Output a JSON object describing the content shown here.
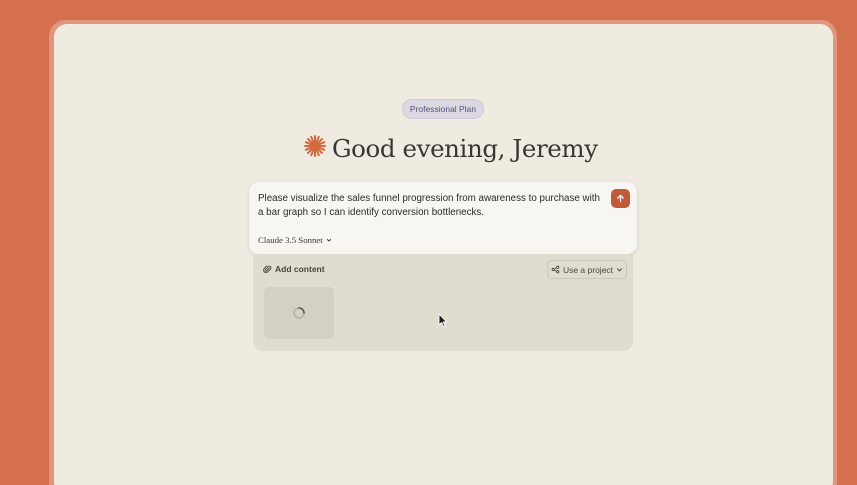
{
  "header": {
    "plan_badge": "Professional Plan",
    "greeting": "Good evening, Jeremy"
  },
  "composer": {
    "prompt_text": "Please visualize the sales funnel progression from awareness to purchase with a bar graph so I can identify conversion bottlenecks.",
    "model_label": "Claude 3.5 Sonnet",
    "send_icon": "arrow-up-icon"
  },
  "tray": {
    "add_content_label": "Add content",
    "use_project_label": "Use a project",
    "upload_status": "loading"
  },
  "colors": {
    "background": "#d5704f",
    "window": "#efebe1",
    "accent": "#c25a3a",
    "logo": "#d4693f"
  }
}
